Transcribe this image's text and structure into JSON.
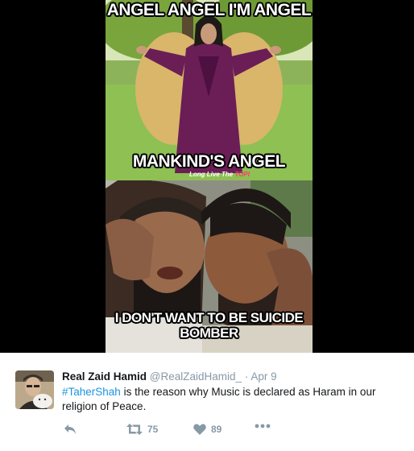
{
  "meme": {
    "caption_top": "ANGEL ANGEL I'M ANGEL",
    "caption_middle": "MANKIND'S ANGEL",
    "watermark_text": "Long Live The",
    "watermark_logo": "TOPI",
    "caption_bottom_line1": "I DON'T WANT TO BE SUICIDE",
    "caption_bottom_line2": "BOMBER"
  },
  "tweet": {
    "display_name": "Real Zaid Hamid",
    "handle": "@RealZaidHamid_",
    "separator": "·",
    "date": "Apr 9",
    "hashtag": "#TaherShah",
    "text": " is the reason why Music is declared as Haram in our religion of Peace.",
    "actions": {
      "reply_icon": "reply-icon",
      "retweet_icon": "retweet-icon",
      "retweet_count": "75",
      "like_icon": "heart-icon",
      "like_count": "89",
      "more_icon": "more-icon"
    }
  },
  "colors": {
    "hashtag": "#1b95e0",
    "muted": "#8899a6",
    "text": "#14171a",
    "media_bg": "#000000"
  }
}
